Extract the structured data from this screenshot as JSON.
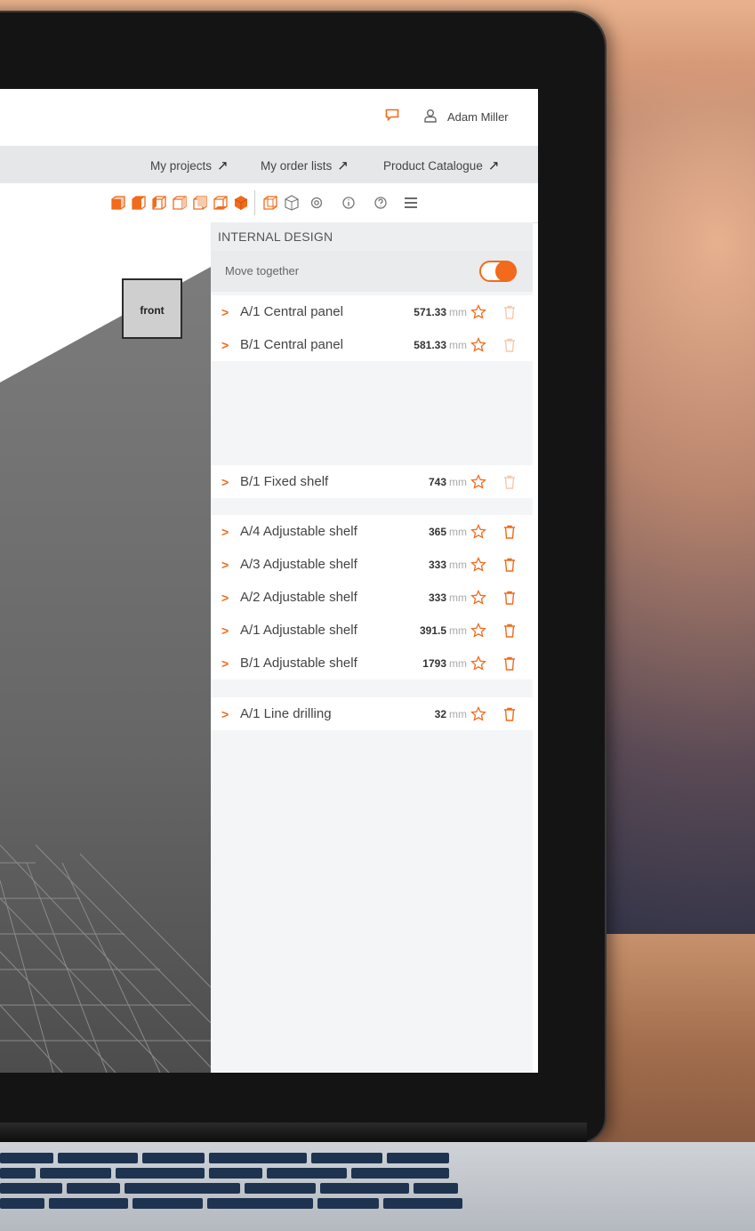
{
  "header": {
    "user_name": "Adam Miller"
  },
  "nav": {
    "links": [
      {
        "label": "My projects",
        "arrow": "↗"
      },
      {
        "label": "My order lists",
        "arrow": "↗"
      },
      {
        "label": "Product Catalogue",
        "arrow": "↗"
      }
    ]
  },
  "toolbar": {
    "icons": [
      "cube-front-view-icon",
      "cube-top-view-icon",
      "cube-left-view-icon",
      "cube-right-view-icon",
      "cube-back-view-icon",
      "cube-bottom-view-icon",
      "cube-solid-view-icon",
      "wireframe-view-icon",
      "perspective-view-icon",
      "settings-icon",
      "info-icon",
      "help-icon",
      "menu-icon"
    ]
  },
  "viewport": {
    "front_label": "front"
  },
  "panel": {
    "title": "INTERNAL DESIGN",
    "move_together_label": "Move together",
    "move_together_on": true,
    "groups": [
      {
        "items": [
          {
            "name": "A/1 Central panel",
            "value": "571.33",
            "unit": "mm",
            "deletable": false
          },
          {
            "name": "B/1 Central panel",
            "value": "581.33",
            "unit": "mm",
            "deletable": false
          }
        ]
      },
      {
        "items": [
          {
            "name": "B/1 Fixed shelf",
            "value": "743",
            "unit": "mm",
            "deletable": false
          }
        ]
      },
      {
        "items": [
          {
            "name": "A/4 Adjustable shelf",
            "value": "365",
            "unit": "mm",
            "deletable": true
          },
          {
            "name": "A/3 Adjustable shelf",
            "value": "333",
            "unit": "mm",
            "deletable": true
          },
          {
            "name": "A/2 Adjustable shelf",
            "value": "333",
            "unit": "mm",
            "deletable": true
          },
          {
            "name": "A/1 Adjustable shelf",
            "value": "391.5",
            "unit": "mm",
            "deletable": true
          },
          {
            "name": "B/1 Adjustable shelf",
            "value": "1793",
            "unit": "mm",
            "deletable": true
          }
        ]
      },
      {
        "items": [
          {
            "name": "A/1 Line drilling",
            "value": "32",
            "unit": "mm",
            "deletable": true
          }
        ]
      }
    ]
  },
  "colors": {
    "accent": "#f26a1b",
    "accent_faded": "#f7c9ad",
    "navbar_bg": "#e6e7e9",
    "panel_bg": "#f4f5f6",
    "viewport_plane": "#6d6d6d"
  }
}
